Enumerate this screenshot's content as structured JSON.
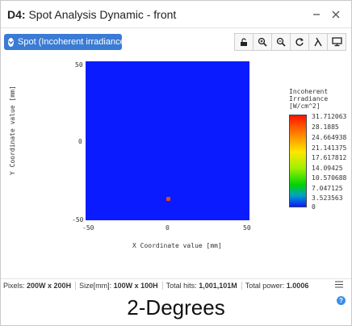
{
  "window": {
    "title_prefix": "D4:",
    "title": "Spot Analysis Dynamic - front"
  },
  "toolbar": {
    "spot_button_label": "Spot (Incoherent irradiance)",
    "tools": [
      "lock-icon",
      "zoom-in-icon",
      "zoom-out-icon",
      "refresh-icon",
      "lambda-icon",
      "monitor-icon"
    ]
  },
  "plot": {
    "xlabel": "X Coordinate value [mm]",
    "ylabel": "Y Coordinate value [mm]",
    "x_ticks": [
      "-50",
      "0",
      "50"
    ],
    "y_ticks": [
      "50",
      "0",
      "-50"
    ],
    "background_color": "#0a1cff"
  },
  "colorbar": {
    "title_lines": [
      "Incoherent",
      "Irradiance",
      "[W/cm^2]"
    ],
    "labels": [
      "31.712063",
      "28.1885",
      "24.664938",
      "21.141375",
      "17.617812",
      "14.09425",
      "10.570688",
      "7.047125",
      "3.523563",
      "0"
    ]
  },
  "status": {
    "pixels_label": "Pixels:",
    "pixels_value": "200W x 200H",
    "size_label": "Size[mm]:",
    "size_value": "100W x 100H",
    "hits_label": "Total hits:",
    "hits_value": "1,001,101M",
    "power_label": "Total power:",
    "power_value": "1.0006"
  },
  "caption": "2-Degrees"
}
